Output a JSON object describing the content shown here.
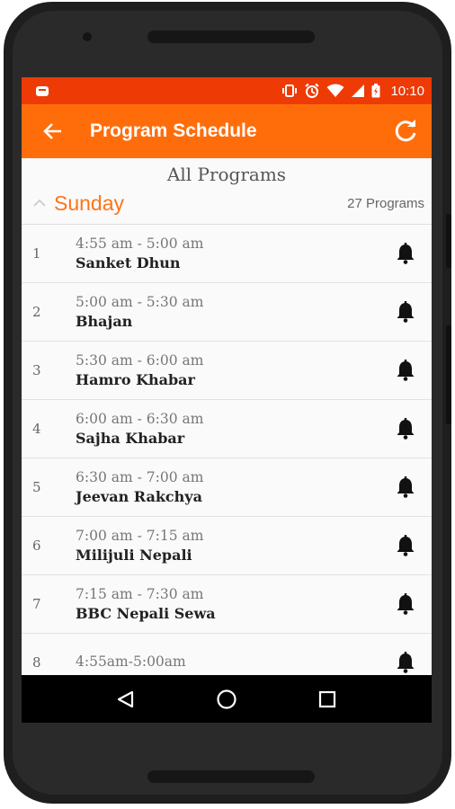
{
  "status_bar": {
    "time": "10:10",
    "icons": [
      "android-app-icon",
      "vibrate-icon",
      "alarm-icon",
      "wifi-icon",
      "signal-icon",
      "battery-charging-icon"
    ]
  },
  "app_bar": {
    "title": "Program Schedule",
    "back_icon": "arrow-back-icon",
    "refresh_icon": "refresh-icon"
  },
  "section": {
    "header": "All Programs",
    "day": "Sunday",
    "count": "27 Programs"
  },
  "programs": [
    {
      "num": "1",
      "time": "4:55 am - 5:00 am",
      "name": "Sanket Dhun"
    },
    {
      "num": "2",
      "time": "5:00 am - 5:30 am",
      "name": "Bhajan"
    },
    {
      "num": "3",
      "time": "5:30 am - 6:00 am",
      "name": "Hamro Khabar"
    },
    {
      "num": "4",
      "time": "6:00 am - 6:30 am",
      "name": "Sajha Khabar"
    },
    {
      "num": "5",
      "time": "6:30 am - 7:00 am",
      "name": "Jeevan Rakchya"
    },
    {
      "num": "6",
      "time": "7:00 am - 7:15 am",
      "name": "Milijuli Nepali"
    },
    {
      "num": "7",
      "time": "7:15 am - 7:30 am",
      "name": "BBC Nepali Sewa"
    },
    {
      "num": "8",
      "time": "4:55am-5:00am",
      "name": ""
    }
  ],
  "colors": {
    "status_bar": "#ee3a05",
    "app_bar": "#ff6d0b",
    "accent": "#ff7417"
  },
  "nav": [
    "back-icon",
    "home-icon",
    "recents-icon"
  ]
}
